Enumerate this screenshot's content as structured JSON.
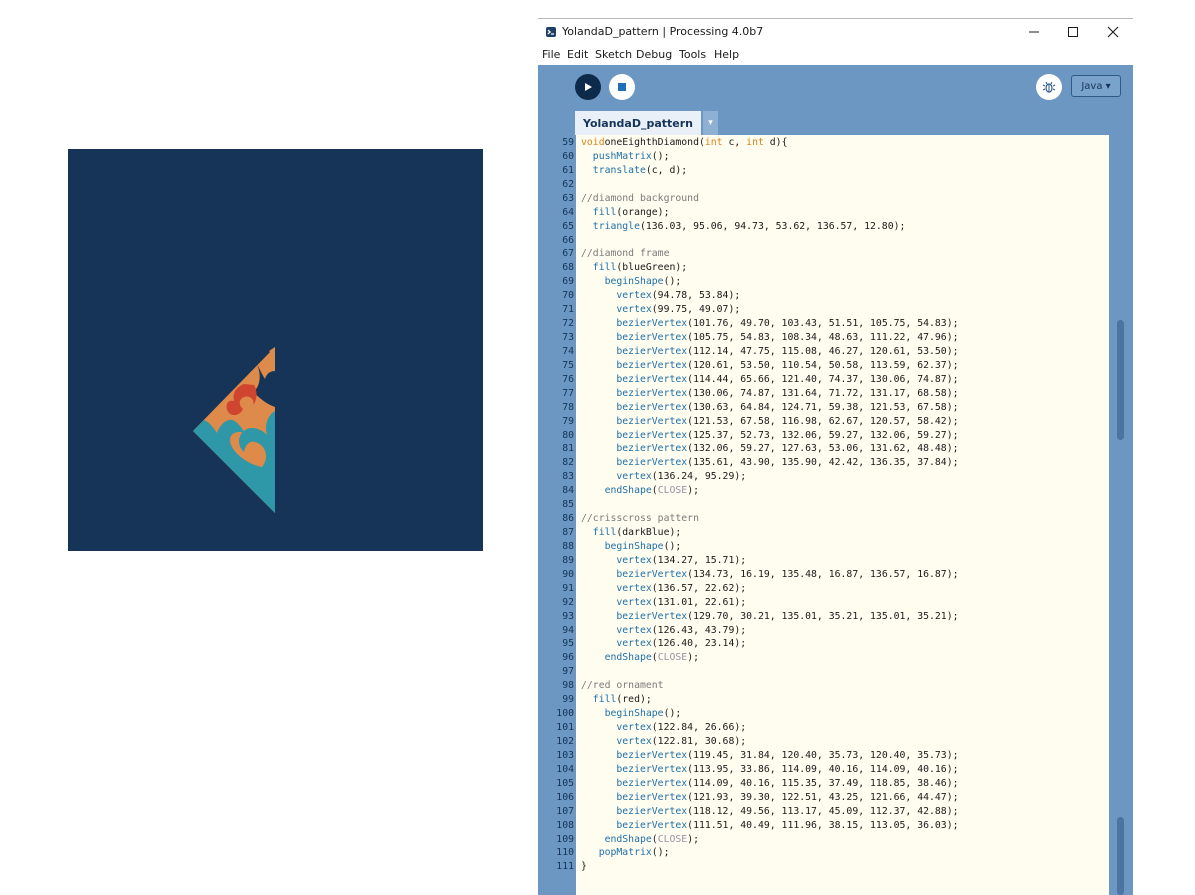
{
  "window": {
    "title": "YolandaD_pattern | Processing 4.0b7",
    "menus": [
      "File",
      "Edit",
      "Sketch",
      "Debug",
      "Tools",
      "Help"
    ]
  },
  "toolbar": {
    "mode": "Java ▾",
    "tab_label": "YolandaD_pattern",
    "tab_menu": "▾"
  },
  "sketch": {
    "colors": {
      "background": "#163457",
      "teal": "#2e97a8",
      "orange": "#dd8a4a",
      "red": "#d0452f",
      "dark_blue": "#163457"
    }
  },
  "colors": {
    "toolbar": "#6b97c2",
    "editor_bg": "#fffdf0",
    "keyword": "#d9831f",
    "function": "#1f6fa8",
    "comment": "#7b7b7b"
  },
  "code_lines": [
    {
      "n": "59",
      "t": [
        [
          "kw",
          "void"
        ],
        [
          "",
          "oneEighthDiamond("
        ],
        [
          "kw",
          "int"
        ],
        [
          "",
          " c, "
        ],
        [
          "kw",
          "int"
        ],
        [
          "",
          " d){"
        ]
      ]
    },
    {
      "n": "60",
      "t": [
        [
          "",
          "  "
        ],
        [
          "fn",
          "pushMatrix"
        ],
        [
          "",
          "();"
        ]
      ]
    },
    {
      "n": "61",
      "t": [
        [
          "",
          "  "
        ],
        [
          "fn",
          "translate"
        ],
        [
          "",
          "(c, d);"
        ]
      ]
    },
    {
      "n": "62",
      "t": []
    },
    {
      "n": "63",
      "t": [
        [
          "cm",
          "//diamond background"
        ]
      ]
    },
    {
      "n": "64",
      "t": [
        [
          "",
          "  "
        ],
        [
          "fn",
          "fill"
        ],
        [
          "",
          "(orange);"
        ]
      ]
    },
    {
      "n": "65",
      "t": [
        [
          "",
          "  "
        ],
        [
          "fn",
          "triangle"
        ],
        [
          "",
          "(136.03, 95.06, 94.73, 53.62, 136.57, 12.80);"
        ]
      ]
    },
    {
      "n": "66",
      "t": []
    },
    {
      "n": "67",
      "t": [
        [
          "cm",
          "//diamond frame"
        ]
      ]
    },
    {
      "n": "68",
      "t": [
        [
          "",
          "  "
        ],
        [
          "fn",
          "fill"
        ],
        [
          "",
          "(blueGreen);"
        ]
      ]
    },
    {
      "n": "69",
      "t": [
        [
          "",
          "    "
        ],
        [
          "fn",
          "beginShape"
        ],
        [
          "",
          "();"
        ]
      ]
    },
    {
      "n": "70",
      "t": [
        [
          "",
          "      "
        ],
        [
          "fn",
          "vertex"
        ],
        [
          "",
          "(94.78, 53.84);"
        ]
      ]
    },
    {
      "n": "71",
      "t": [
        [
          "",
          "      "
        ],
        [
          "fn",
          "vertex"
        ],
        [
          "",
          "(99.75, 49.07);"
        ]
      ]
    },
    {
      "n": "72",
      "t": [
        [
          "",
          "      "
        ],
        [
          "fn",
          "bezierVertex"
        ],
        [
          "",
          "(101.76, 49.70, 103.43, 51.51, 105.75, 54.83);"
        ]
      ]
    },
    {
      "n": "73",
      "t": [
        [
          "",
          "      "
        ],
        [
          "fn",
          "bezierVertex"
        ],
        [
          "",
          "(105.75, 54.83, 108.34, 48.63, 111.22, 47.96);"
        ]
      ]
    },
    {
      "n": "74",
      "t": [
        [
          "",
          "      "
        ],
        [
          "fn",
          "bezierVertex"
        ],
        [
          "",
          "(112.14, 47.75, 115.08, 46.27, 120.61, 53.50);"
        ]
      ]
    },
    {
      "n": "75",
      "t": [
        [
          "",
          "      "
        ],
        [
          "fn",
          "bezierVertex"
        ],
        [
          "",
          "(120.61, 53.50, 110.54, 50.58, 113.59, 62.37);"
        ]
      ]
    },
    {
      "n": "76",
      "t": [
        [
          "",
          "      "
        ],
        [
          "fn",
          "bezierVertex"
        ],
        [
          "",
          "(114.44, 65.66, 121.40, 74.37, 130.06, 74.87);"
        ]
      ]
    },
    {
      "n": "77",
      "t": [
        [
          "",
          "      "
        ],
        [
          "fn",
          "bezierVertex"
        ],
        [
          "",
          "(130.06, 74.87, 131.64, 71.72, 131.17, 68.58);"
        ]
      ]
    },
    {
      "n": "78",
      "t": [
        [
          "",
          "      "
        ],
        [
          "fn",
          "bezierVertex"
        ],
        [
          "",
          "(130.63, 64.84, 124.71, 59.38, 121.53, 67.58);"
        ]
      ]
    },
    {
      "n": "79",
      "t": [
        [
          "",
          "      "
        ],
        [
          "fn",
          "bezierVertex"
        ],
        [
          "",
          "(121.53, 67.58, 116.98, 62.67, 120.57, 58.42);"
        ]
      ]
    },
    {
      "n": "80",
      "t": [
        [
          "",
          "      "
        ],
        [
          "fn",
          "bezierVertex"
        ],
        [
          "",
          "(125.37, 52.73, 132.06, 59.27, 132.06, 59.27);"
        ]
      ]
    },
    {
      "n": "81",
      "t": [
        [
          "",
          "      "
        ],
        [
          "fn",
          "bezierVertex"
        ],
        [
          "",
          "(132.06, 59.27, 127.63, 53.06, 131.62, 48.48);"
        ]
      ]
    },
    {
      "n": "82",
      "t": [
        [
          "",
          "      "
        ],
        [
          "fn",
          "bezierVertex"
        ],
        [
          "",
          "(135.61, 43.90, 135.90, 42.42, 136.35, 37.84);"
        ]
      ]
    },
    {
      "n": "83",
      "t": [
        [
          "",
          "      "
        ],
        [
          "fn",
          "vertex"
        ],
        [
          "",
          "(136.24, 95.29);"
        ]
      ]
    },
    {
      "n": "84",
      "t": [
        [
          "",
          "    "
        ],
        [
          "fn",
          "endShape"
        ],
        [
          "",
          "("
        ],
        [
          "cn",
          "CLOSE"
        ],
        [
          "",
          ");"
        ]
      ]
    },
    {
      "n": "85",
      "t": []
    },
    {
      "n": "86",
      "t": [
        [
          "cm",
          "//crisscross pattern"
        ]
      ]
    },
    {
      "n": "87",
      "t": [
        [
          "",
          "  "
        ],
        [
          "fn",
          "fill"
        ],
        [
          "",
          "(darkBlue);"
        ]
      ]
    },
    {
      "n": "88",
      "t": [
        [
          "",
          "    "
        ],
        [
          "fn",
          "beginShape"
        ],
        [
          "",
          "();"
        ]
      ]
    },
    {
      "n": "89",
      "t": [
        [
          "",
          "      "
        ],
        [
          "fn",
          "vertex"
        ],
        [
          "",
          "(134.27, 15.71);"
        ]
      ]
    },
    {
      "n": "90",
      "t": [
        [
          "",
          "      "
        ],
        [
          "fn",
          "bezierVertex"
        ],
        [
          "",
          "(134.73, 16.19, 135.48, 16.87, 136.57, 16.87);"
        ]
      ]
    },
    {
      "n": "91",
      "t": [
        [
          "",
          "      "
        ],
        [
          "fn",
          "vertex"
        ],
        [
          "",
          "(136.57, 22.62);"
        ]
      ]
    },
    {
      "n": "92",
      "t": [
        [
          "",
          "      "
        ],
        [
          "fn",
          "vertex"
        ],
        [
          "",
          "(131.01, 22.61);"
        ]
      ]
    },
    {
      "n": "93",
      "t": [
        [
          "",
          "      "
        ],
        [
          "fn",
          "bezierVertex"
        ],
        [
          "",
          "(129.70, 30.21, 135.01, 35.21, 135.01, 35.21);"
        ]
      ]
    },
    {
      "n": "94",
      "t": [
        [
          "",
          "      "
        ],
        [
          "fn",
          "vertex"
        ],
        [
          "",
          "(126.43, 43.79);"
        ]
      ]
    },
    {
      "n": "95",
      "t": [
        [
          "",
          "      "
        ],
        [
          "fn",
          "vertex"
        ],
        [
          "",
          "(126.40, 23.14);"
        ]
      ]
    },
    {
      "n": "96",
      "t": [
        [
          "",
          "    "
        ],
        [
          "fn",
          "endShape"
        ],
        [
          "",
          "("
        ],
        [
          "cn",
          "CLOSE"
        ],
        [
          "",
          ");"
        ]
      ]
    },
    {
      "n": "97",
      "t": []
    },
    {
      "n": "98",
      "t": [
        [
          "cm",
          "//red ornament"
        ]
      ]
    },
    {
      "n": "99",
      "t": [
        [
          "",
          "  "
        ],
        [
          "fn",
          "fill"
        ],
        [
          "",
          "(red);"
        ]
      ]
    },
    {
      "n": "100",
      "t": [
        [
          "",
          "    "
        ],
        [
          "fn",
          "beginShape"
        ],
        [
          "",
          "();"
        ]
      ]
    },
    {
      "n": "101",
      "t": [
        [
          "",
          "      "
        ],
        [
          "fn",
          "vertex"
        ],
        [
          "",
          "(122.84, 26.66);"
        ]
      ]
    },
    {
      "n": "102",
      "t": [
        [
          "",
          "      "
        ],
        [
          "fn",
          "vertex"
        ],
        [
          "",
          "(122.81, 30.68);"
        ]
      ]
    },
    {
      "n": "103",
      "t": [
        [
          "",
          "      "
        ],
        [
          "fn",
          "bezierVertex"
        ],
        [
          "",
          "(119.45, 31.84, 120.40, 35.73, 120.40, 35.73);"
        ]
      ]
    },
    {
      "n": "104",
      "t": [
        [
          "",
          "      "
        ],
        [
          "fn",
          "bezierVertex"
        ],
        [
          "",
          "(113.95, 33.86, 114.09, 40.16, 114.09, 40.16);"
        ]
      ]
    },
    {
      "n": "105",
      "t": [
        [
          "",
          "      "
        ],
        [
          "fn",
          "bezierVertex"
        ],
        [
          "",
          "(114.09, 40.16, 115.35, 37.49, 118.85, 38.46);"
        ]
      ]
    },
    {
      "n": "106",
      "t": [
        [
          "",
          "      "
        ],
        [
          "fn",
          "bezierVertex"
        ],
        [
          "",
          "(121.93, 39.30, 122.51, 43.25, 121.66, 44.47);"
        ]
      ]
    },
    {
      "n": "107",
      "t": [
        [
          "",
          "      "
        ],
        [
          "fn",
          "bezierVertex"
        ],
        [
          "",
          "(118.12, 49.56, 113.17, 45.09, 112.37, 42.88);"
        ]
      ]
    },
    {
      "n": "108",
      "t": [
        [
          "",
          "      "
        ],
        [
          "fn",
          "bezierVertex"
        ],
        [
          "",
          "(111.51, 40.49, 111.96, 38.15, 113.05, 36.03);"
        ]
      ]
    },
    {
      "n": "109",
      "t": [
        [
          "",
          "    "
        ],
        [
          "fn",
          "endShape"
        ],
        [
          "",
          "("
        ],
        [
          "cn",
          "CLOSE"
        ],
        [
          "",
          ");"
        ]
      ]
    },
    {
      "n": "110",
      "t": [
        [
          "",
          "   "
        ],
        [
          "fn",
          "popMatrix"
        ],
        [
          "",
          "();"
        ]
      ]
    },
    {
      "n": "111",
      "t": [
        [
          "",
          "}"
        ]
      ]
    }
  ]
}
